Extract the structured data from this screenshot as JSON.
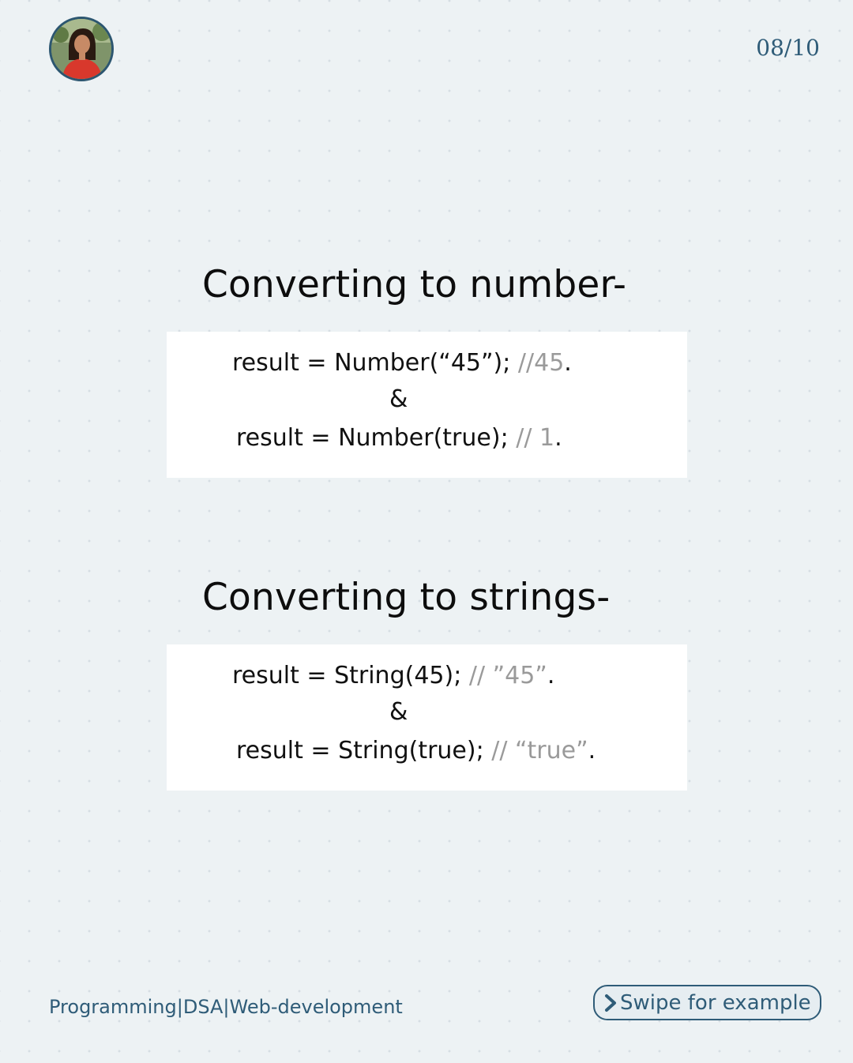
{
  "header": {
    "page_number": "08/10"
  },
  "sections": [
    {
      "title": "Converting to number-",
      "line1": {
        "code": "result = Number(“45”); ",
        "comment": "//45",
        "end": "."
      },
      "separator": "&",
      "line2": {
        "code": "result = Number(true); ",
        "comment": "// 1",
        "end": "."
      }
    },
    {
      "title": "Converting to strings-",
      "line1": {
        "code": "result = String(45); ",
        "comment": "// ”45”",
        "end": "."
      },
      "separator": "&",
      "line2": {
        "code": "result = String(true); ",
        "comment": "// “true”",
        "end": "."
      }
    }
  ],
  "footer": {
    "tagline": "Programming|DSA|Web-development",
    "swipe_label": "Swipe for example"
  },
  "colors": {
    "accent": "#2f5c78",
    "background": "#edf2f4",
    "comment": "#9a9a9a"
  },
  "icons": {
    "avatar": "profile-photo",
    "swipe": "chevron-right-icon"
  }
}
